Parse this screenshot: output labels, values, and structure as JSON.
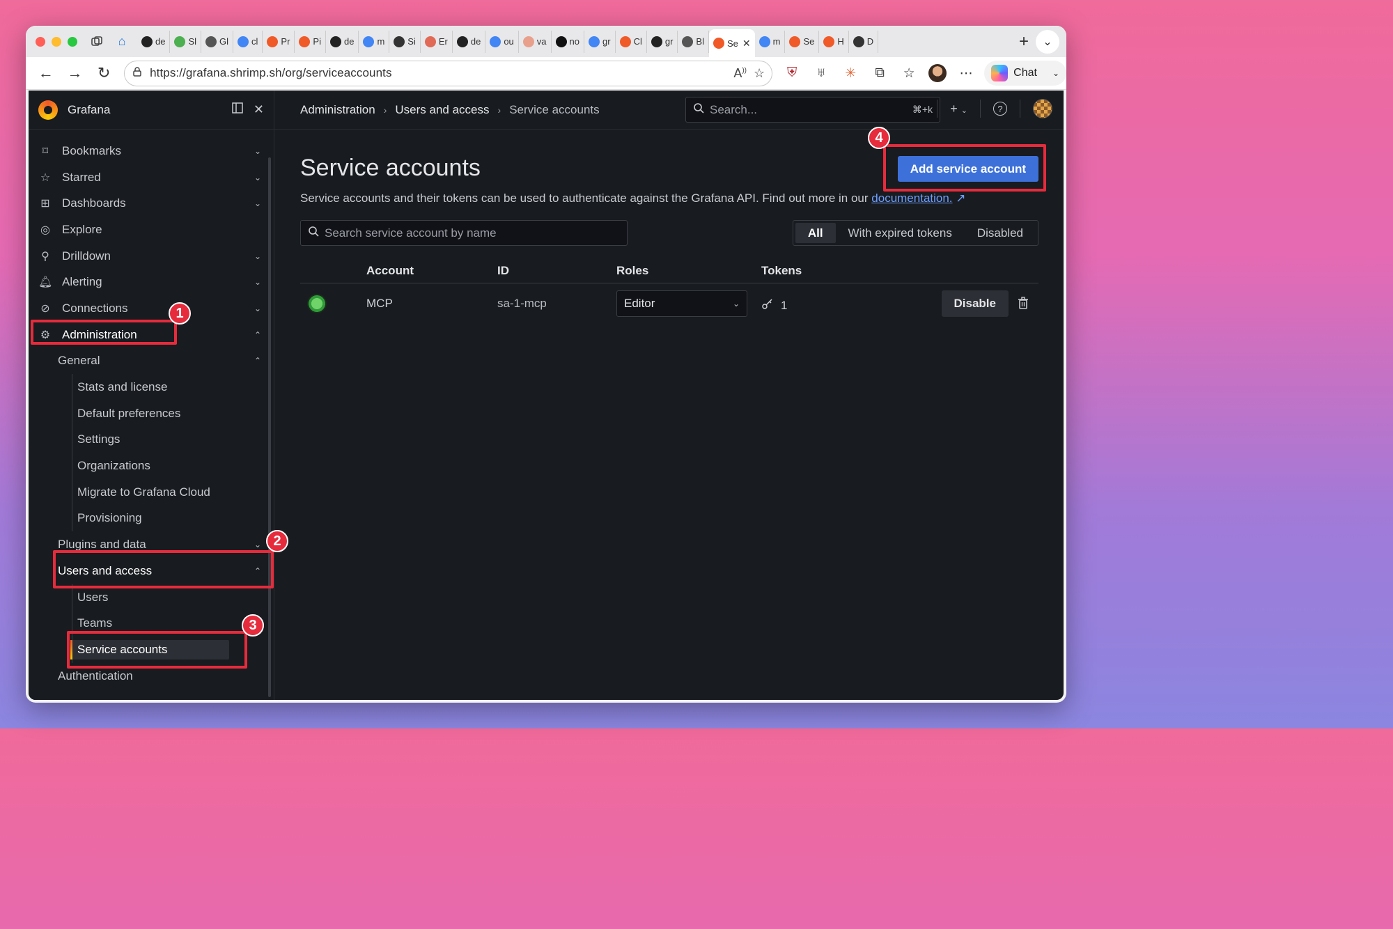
{
  "browser": {
    "tabs": [
      {
        "label": "de",
        "icon": "github-icon",
        "color": "#222222"
      },
      {
        "label": "Sl",
        "icon": "leaf-icon",
        "color": "#4caf50"
      },
      {
        "label": "Gl",
        "icon": "circle-icon",
        "color": "#555555"
      },
      {
        "label": "cl",
        "icon": "google-icon",
        "color": "#4285f4"
      },
      {
        "label": "Pr",
        "icon": "grafana-icon",
        "color": "#f05a28"
      },
      {
        "label": "Pi",
        "icon": "grafana-icon",
        "color": "#f05a28"
      },
      {
        "label": "de",
        "icon": "github-icon",
        "color": "#222222"
      },
      {
        "label": "m",
        "icon": "google-icon",
        "color": "#4285f4"
      },
      {
        "label": "Si",
        "icon": "fan-icon",
        "color": "#333333"
      },
      {
        "label": "Er",
        "icon": "app-icon",
        "color": "#e06a56"
      },
      {
        "label": "de",
        "icon": "github-icon",
        "color": "#222222"
      },
      {
        "label": "ou",
        "icon": "google-icon",
        "color": "#4285f4"
      },
      {
        "label": "va",
        "icon": "wave-icon",
        "color": "#e8a08c"
      },
      {
        "label": "no",
        "icon": "notion-icon",
        "color": "#111111"
      },
      {
        "label": "gr",
        "icon": "google-icon",
        "color": "#4285f4"
      },
      {
        "label": "Cl",
        "icon": "grafana-icon",
        "color": "#f05a28"
      },
      {
        "label": "gr",
        "icon": "github-icon",
        "color": "#222222"
      },
      {
        "label": "Bl",
        "icon": "medium-icon",
        "color": "#555555"
      }
    ],
    "active_tab": {
      "label": "Se",
      "icon": "grafana-icon"
    },
    "tabs_after": [
      {
        "label": "m",
        "icon": "google-icon",
        "color": "#4285f4"
      },
      {
        "label": "Se",
        "icon": "grafana-icon",
        "color": "#f05a28"
      },
      {
        "label": "H",
        "icon": "grafana-icon",
        "color": "#f05a28"
      },
      {
        "label": "D",
        "icon": "media-icon",
        "color": "#333333"
      }
    ],
    "url": "https://grafana.shrimp.sh/org/serviceaccounts",
    "chat_label": "Chat"
  },
  "grafana": {
    "brand": "Grafana",
    "nav": {
      "bookmarks": "Bookmarks",
      "starred": "Starred",
      "dashboards": "Dashboards",
      "explore": "Explore",
      "drilldown": "Drilldown",
      "alerting": "Alerting",
      "connections": "Connections",
      "administration": "Administration",
      "general": "General",
      "stats": "Stats and license",
      "default_prefs": "Default preferences",
      "settings": "Settings",
      "organizations": "Organizations",
      "migrate": "Migrate to Grafana Cloud",
      "provisioning": "Provisioning",
      "plugins": "Plugins and data",
      "users_access": "Users and access",
      "users": "Users",
      "teams": "Teams",
      "service_accounts": "Service accounts",
      "authentication": "Authentication"
    },
    "breadcrumb": [
      "Administration",
      "Users and access",
      "Service accounts"
    ],
    "search_placeholder": "Search...",
    "search_shortcut": "⌘+k",
    "page": {
      "title": "Service accounts",
      "description": "Service accounts and their tokens can be used to authenticate against the Grafana API. Find out more in our ",
      "doc_link": "documentation.",
      "add_button": "Add service account",
      "search_placeholder": "Search service account by name",
      "filters": [
        "All",
        "With expired tokens",
        "Disabled"
      ],
      "active_filter": "All"
    },
    "table": {
      "headers": {
        "account": "Account",
        "id": "ID",
        "roles": "Roles",
        "tokens": "Tokens"
      },
      "rows": [
        {
          "account": "MCP",
          "id": "sa-1-mcp",
          "role": "Editor",
          "tokens": "1",
          "action": "Disable"
        }
      ]
    }
  },
  "annotations": [
    "1",
    "2",
    "3",
    "4"
  ],
  "colors": {
    "accent": "#3d71d9",
    "annotation": "#e62b3c",
    "bg": "#181b1f"
  }
}
